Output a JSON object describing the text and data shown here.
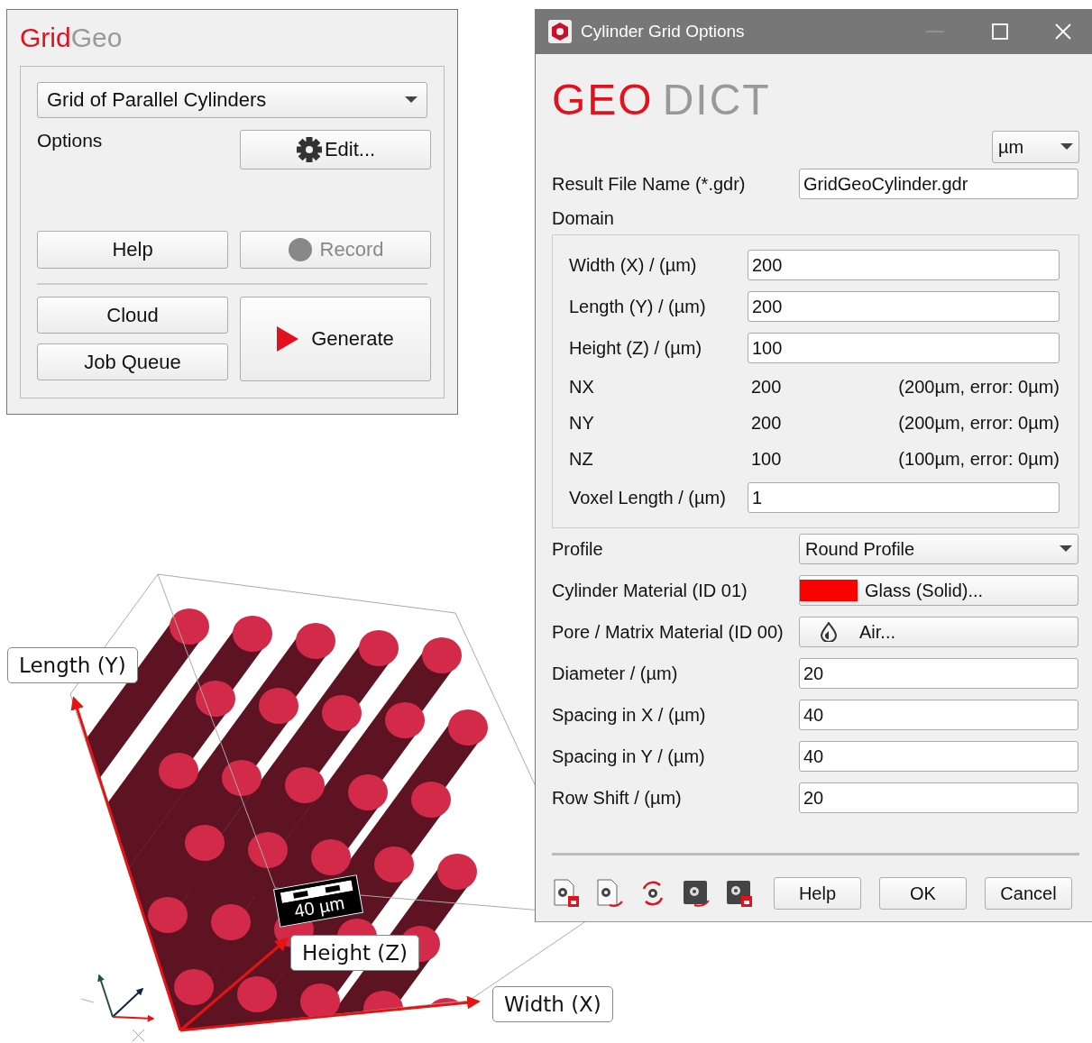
{
  "gridgeo_panel": {
    "title": [
      "Grid",
      "Geo"
    ],
    "type_dropdown": "Grid of Parallel Cylinders",
    "options_label": "Options",
    "edit_button": "Edit...",
    "buttons": [
      {
        "label": "Help",
        "kind": "plain",
        "disabled": false
      },
      {
        "label": "Record",
        "kind": "record",
        "disabled": true
      }
    ],
    "queue_buttons": [
      "Cloud",
      "Job Queue"
    ],
    "generate_button": "Generate"
  },
  "dialog": {
    "title": "Cylinder Grid Options",
    "logo": [
      "GEO",
      "DICT"
    ],
    "unit_dropdown": "µm",
    "result_file": {
      "label": "Result File Name (*.gdr)",
      "value": "GridGeoCylinder.gdr"
    },
    "domain": {
      "label": "Domain",
      "rows": [
        {
          "kind": "field",
          "label": "Width (X) / (µm)",
          "value": "200"
        },
        {
          "kind": "field",
          "label": "Length (Y) / (µm)",
          "value": "200"
        },
        {
          "kind": "field",
          "label": "Height (Z) / (µm)",
          "value": "100"
        },
        {
          "kind": "readout",
          "label": "NX",
          "value": "200",
          "note": "(200µm, error: 0µm)"
        },
        {
          "kind": "readout",
          "label": "NY",
          "value": "200",
          "note": "(200µm, error: 0µm)"
        },
        {
          "kind": "readout",
          "label": "NZ",
          "value": "100",
          "note": "(100µm, error: 0µm)"
        },
        {
          "kind": "field",
          "label": "Voxel Length / (µm)",
          "value": "1"
        }
      ]
    },
    "rows": [
      {
        "kind": "dropdown",
        "label": "Profile",
        "value": "Round Profile"
      },
      {
        "kind": "material",
        "label": "Cylinder Material (ID 01)",
        "value": "Glass (Solid)...",
        "color": "#ff0000"
      },
      {
        "kind": "material_drop",
        "label": "Pore / Matrix Material (ID 00)",
        "value": "Air..."
      },
      {
        "kind": "field",
        "label": "Diameter / (µm)",
        "value": "20"
      },
      {
        "kind": "field",
        "label": "Spacing in X / (µm)",
        "value": "40"
      },
      {
        "kind": "field",
        "label": "Spacing in Y / (µm)",
        "value": "40"
      },
      {
        "kind": "field",
        "label": "Row Shift / (µm)",
        "value": "20"
      }
    ],
    "buttons": [
      "Help",
      "OK",
      "Cancel"
    ]
  },
  "scene": {
    "axis_labels": {
      "length": "Length (Y)",
      "height": "Height (Z)",
      "width": "Width (X)"
    },
    "scale_bar": "40 µm"
  }
}
